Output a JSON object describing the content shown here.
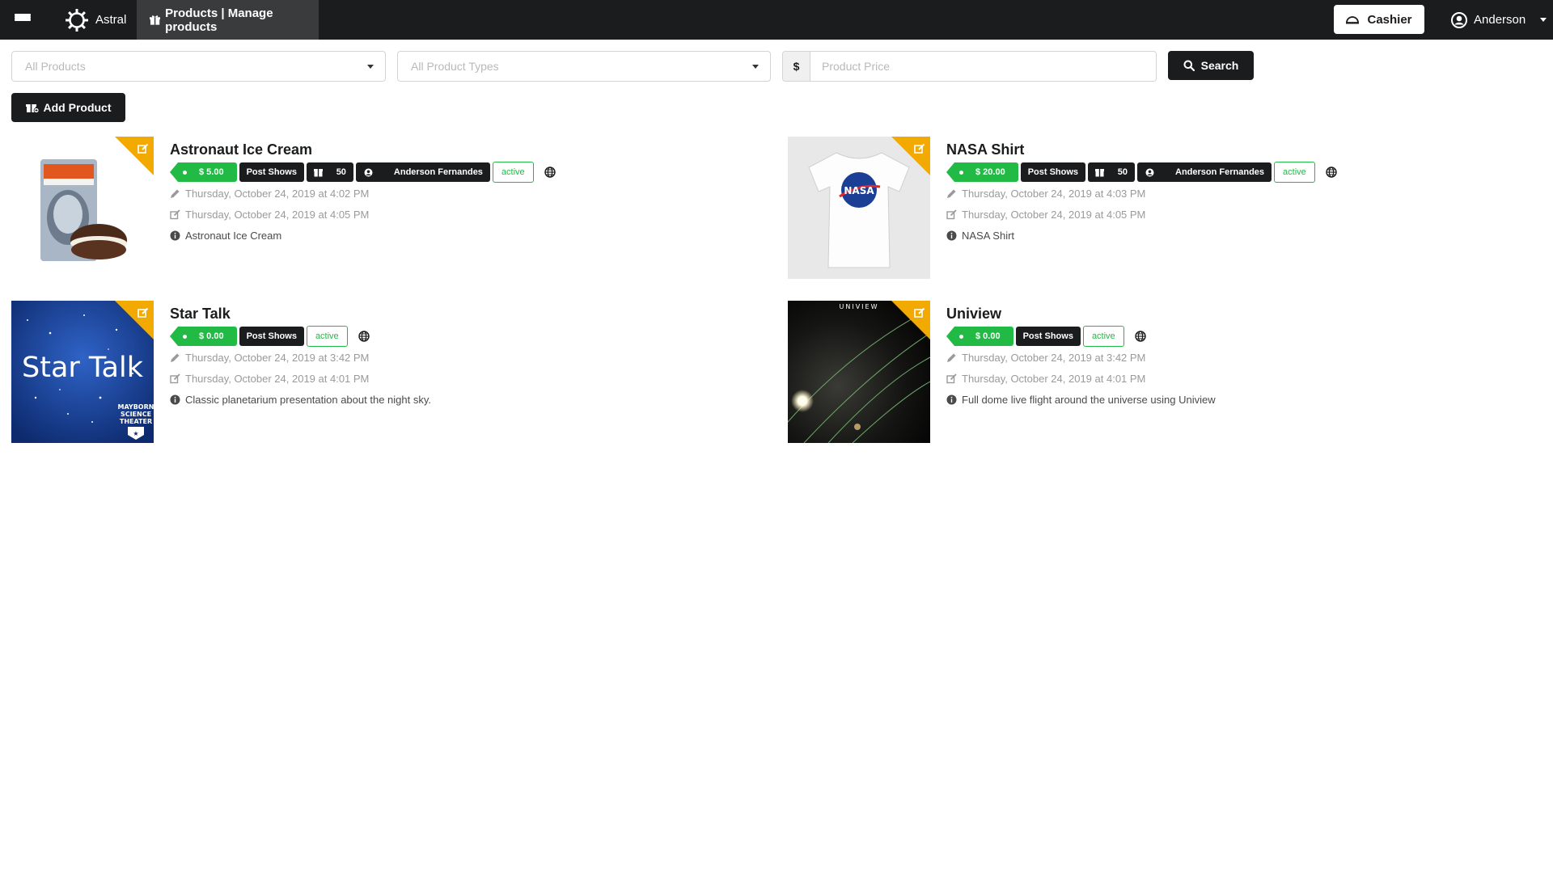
{
  "app": {
    "brand": "Astral",
    "nav_active": "Products | Manage products",
    "cashier_label": "Cashier",
    "user_name": "Anderson"
  },
  "filters": {
    "products_placeholder": "All Products",
    "types_placeholder": "All Product Types",
    "currency_symbol": "$",
    "price_placeholder": "Product Price",
    "search_label": "Search"
  },
  "actions": {
    "add_product_label": "Add Product"
  },
  "colors": {
    "topbar": "#1b1c1d",
    "accent_green": "#21ba45",
    "corner_yellow": "#f2a900"
  },
  "products": [
    {
      "name": "Astronaut Ice Cream",
      "price": "$ 5.00",
      "type": "Post Shows",
      "quantity": "50",
      "owner": "Anderson Fernandes",
      "status": "active",
      "created": "Thursday, October 24, 2019 at 4:02 PM",
      "edited": "Thursday, October 24, 2019 at 4:05 PM",
      "description": "Astronaut Ice Cream",
      "image_icon": "ice-cream-package-image"
    },
    {
      "name": "NASA Shirt",
      "price": "$ 20.00",
      "type": "Post Shows",
      "quantity": "50",
      "owner": "Anderson Fernandes",
      "status": "active",
      "created": "Thursday, October 24, 2019 at 4:03 PM",
      "edited": "Thursday, October 24, 2019 at 4:05 PM",
      "description": "NASA Shirt",
      "image_icon": "nasa-tshirt-image",
      "image_text": "NASA"
    },
    {
      "name": "Star Talk",
      "price": "$ 0.00",
      "type": "Post Shows",
      "status": "active",
      "created": "Thursday, October 24, 2019 at 3:42 PM",
      "edited": "Thursday, October 24, 2019 at 4:01 PM",
      "description": "Classic planetarium presentation about the night sky.",
      "image_icon": "star-talk-poster-image",
      "image_text": "Star Talk",
      "image_subtext": [
        "MAYBORN",
        "SCIENCE",
        "THEATER"
      ]
    },
    {
      "name": "Uniview",
      "price": "$ 0.00",
      "type": "Post Shows",
      "status": "active",
      "created": "Thursday, October 24, 2019 at 3:42 PM",
      "edited": "Thursday, October 24, 2019 at 4:01 PM",
      "description": "Full dome live flight around the universe using Uniview",
      "image_icon": "uniview-space-image",
      "image_text": "UNIVIEW"
    }
  ]
}
